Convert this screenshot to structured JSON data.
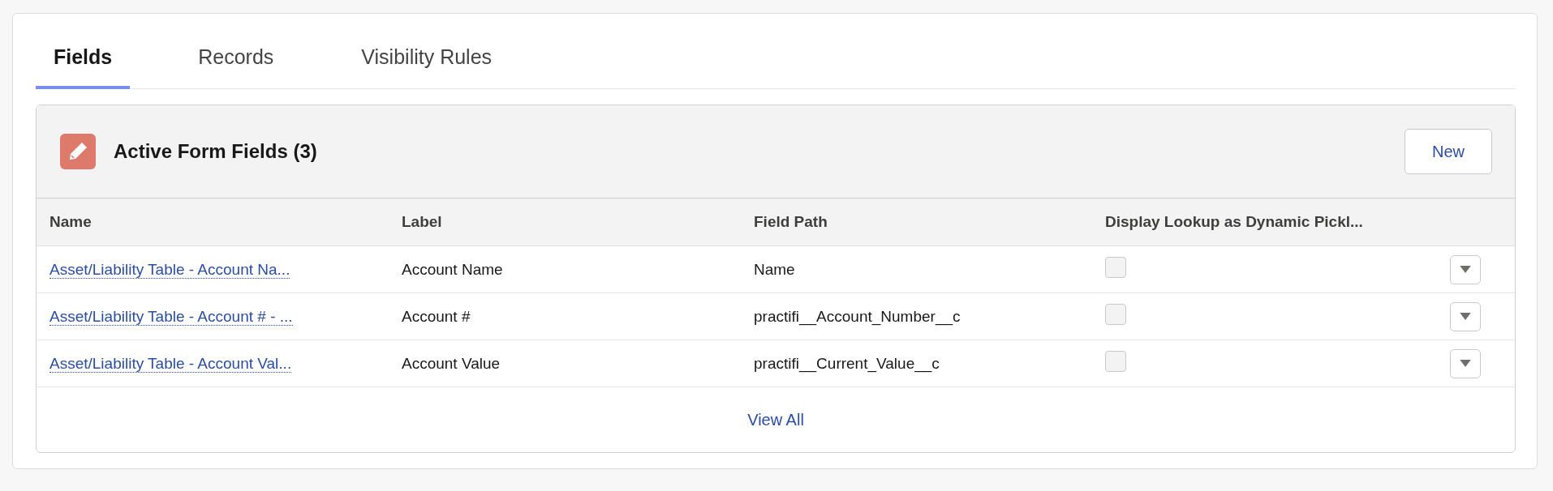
{
  "tabs": [
    {
      "label": "Fields",
      "selected": true
    },
    {
      "label": "Records",
      "selected": false
    },
    {
      "label": "Visibility Rules",
      "selected": false
    }
  ],
  "card": {
    "title": "Active Form Fields (3)",
    "new_button": "New",
    "footer_link": "View All"
  },
  "table": {
    "columns": [
      "Name",
      "Label",
      "Field Path",
      "Display Lookup as Dynamic Pickl..."
    ],
    "rows": [
      {
        "name": "Asset/Liability Table - Account Na...",
        "label": "Account Name",
        "field_path": "Name",
        "checked": false,
        "disabled": true
      },
      {
        "name": "Asset/Liability Table - Account # - ...",
        "label": "Account #",
        "field_path": "practifi__Account_Number__c",
        "checked": false,
        "disabled": true
      },
      {
        "name": "Asset/Liability Table - Account Val...",
        "label": "Account Value",
        "field_path": "practifi__Current_Value__c",
        "checked": false,
        "disabled": true
      }
    ]
  }
}
